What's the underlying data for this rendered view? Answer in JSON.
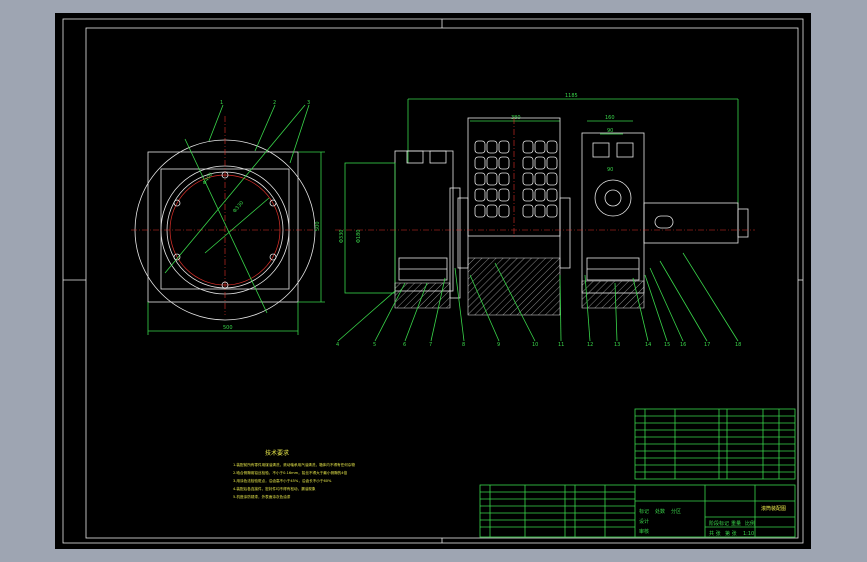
{
  "drawing": {
    "overall_length_dim": "1185",
    "drum_width_dim": "380",
    "shaft_width_dim": "160",
    "shaft_inner_dim": "90",
    "shaft_center_dim": "90",
    "left_height_dim": "500",
    "base_width_dim": "500",
    "circle_dim_1": "Φ400",
    "circle_dim_2": "Φ330",
    "vertical_dim_a": "Φ330",
    "vertical_dim_b": "Φ180",
    "end_view_balloons": [
      "1",
      "2",
      "3"
    ],
    "section_balloons": [
      "4",
      "5",
      "6",
      "7",
      "8",
      "9",
      "10",
      "11",
      "12",
      "13",
      "14",
      "15",
      "16",
      "17",
      "18"
    ]
  },
  "notes": {
    "title": "技术要求",
    "lines": [
      "1.装配前所有零件用煤油清洗，滚动轴承用汽油清洗，箱体内不得有任何杂物",
      "2.啮合侧隙用铅丝检验，不小于0.16mm，铅丝不得大于最小侧隙的4倍",
      "3.用涂色法检验斑点，沿齿高不小于45%，沿齿长不小于60%",
      "4.装配后各连接件，密封件均不得有松动，漏油现象",
      "5.机座涂防锈漆，外表面涂灰色油漆"
    ]
  },
  "title_block": {
    "drawing_name": "滚筒装配图",
    "labels": [
      "标记",
      "处数",
      "分区",
      "更改文件号",
      "签名",
      "年月日",
      "设计",
      "标准化",
      "审核",
      "工艺",
      "批准",
      "阶段标记",
      "重量",
      "比例",
      "共 张",
      "第 张"
    ],
    "scale": "1:10"
  }
}
